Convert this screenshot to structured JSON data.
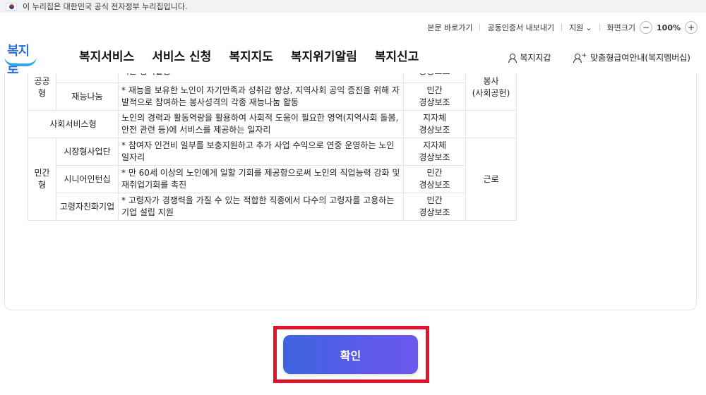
{
  "gov_banner": {
    "text": "이 누리집은 대한민국 공식 전자정부 누리집입니다."
  },
  "util": {
    "skip": "본문 바로가기",
    "cert": "공동인증서 내보내기",
    "support": "지원",
    "zoom_label": "화면크기",
    "zoom_minus": "−",
    "zoom_value": "100%",
    "zoom_plus": "+"
  },
  "logo": {
    "text": "복지로"
  },
  "gnb": [
    "복지서비스",
    "서비스 신청",
    "복지지도",
    "복지위기알림",
    "복지신고"
  ],
  "user_menu": {
    "wallet": "복지지갑",
    "membership": "맞춤형급여안내(복지멤버십)"
  },
  "table": {
    "top_row": {
      "desc": "어는 공익활동",
      "agency": "공공보조",
      "type": "봉사"
    },
    "public": {
      "group": "공공형",
      "talent_name": "재능나눔",
      "talent_desc": "* 재능을 보유한 노인이 자기만족과 성취감 향상, 지역사회 공익 증진을 위해 자발적으로 참여하는 봉사성격의 각종 재능나눔 활동",
      "talent_agency": "민간\n경상보조",
      "type_sub": "(사회공헌)"
    },
    "social": {
      "group": "사회서비스형",
      "desc": "노인의 경력과 활동역량을 활용하여 사회적 도움이 필요한 영역(지역사회 돌봄, 안전 관련 등)에 서비스를 제공하는 일자리",
      "agency": "지자체\n경상보조"
    },
    "private": {
      "group": "민간형",
      "type": "근로",
      "rows": [
        {
          "name": "시장형사업단",
          "desc": "* 참여자 인건비 일부를 보충지원하고 추가 사업 수익으로 연중 운영하는 노인 일자리",
          "agency": "지자체\n경상보조"
        },
        {
          "name": "시니어인턴십",
          "desc": "* 만 60세 이상의 노인에게 일할 기회를 제공함으로써 노인의 직업능력 강화 및 재취업기회를 촉진",
          "agency": "민간\n경상보조"
        },
        {
          "name": "고령자친화기업",
          "desc": "* 고령자가 경쟁력을 가질 수 있는 적합한 직종에서 다수의 고령자를 고용하는 기업 설립 지원",
          "agency": "민간\n경상보조"
        }
      ]
    }
  },
  "confirm_label": "확인"
}
